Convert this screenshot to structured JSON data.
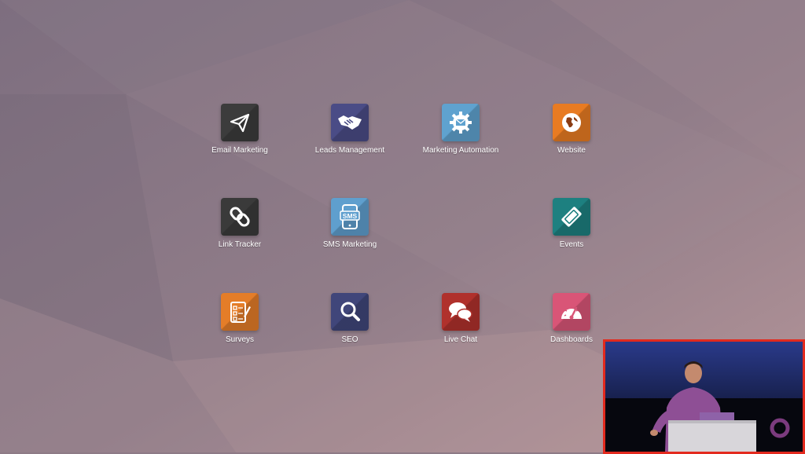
{
  "theme": {
    "background_top": "#7e6f7f",
    "background_bottom": "#b2959a",
    "label_color": "#ffffff",
    "pip_border": "#e32a1e"
  },
  "apps": [
    {
      "label": "Email Marketing",
      "icon": "paper-plane-icon",
      "color": "#3c3c3c"
    },
    {
      "label": "Leads Management",
      "icon": "handshake-icon",
      "color": "#4a4c86"
    },
    {
      "label": "Marketing Automation",
      "icon": "gear-envelope-icon",
      "color": "#5fa2cf"
    },
    {
      "label": "Website",
      "icon": "globe-icon",
      "color": "#e87b22"
    },
    {
      "label": "Link Tracker",
      "icon": "chain-link-icon",
      "color": "#3a3a3a"
    },
    {
      "label": "SMS Marketing",
      "icon": "phone-sms-icon",
      "color": "#5f9fce"
    },
    {
      "label": "Events",
      "icon": "ticket-icon",
      "color": "#1d8080"
    },
    {
      "label": "Surveys",
      "icon": "survey-checklist-icon",
      "color": "#e47d28"
    },
    {
      "label": "SEO",
      "icon": "magnifier-icon",
      "color": "#40467a"
    },
    {
      "label": "Live Chat",
      "icon": "chat-bubbles-icon",
      "color": "#b0312c"
    },
    {
      "label": "Dashboards",
      "icon": "gauge-icon",
      "color": "#d95577"
    }
  ],
  "video_overlay": {
    "content": "presenter-at-podium",
    "logo_icon": "ring-logo-icon",
    "logo_color": "#7b3b7e"
  }
}
